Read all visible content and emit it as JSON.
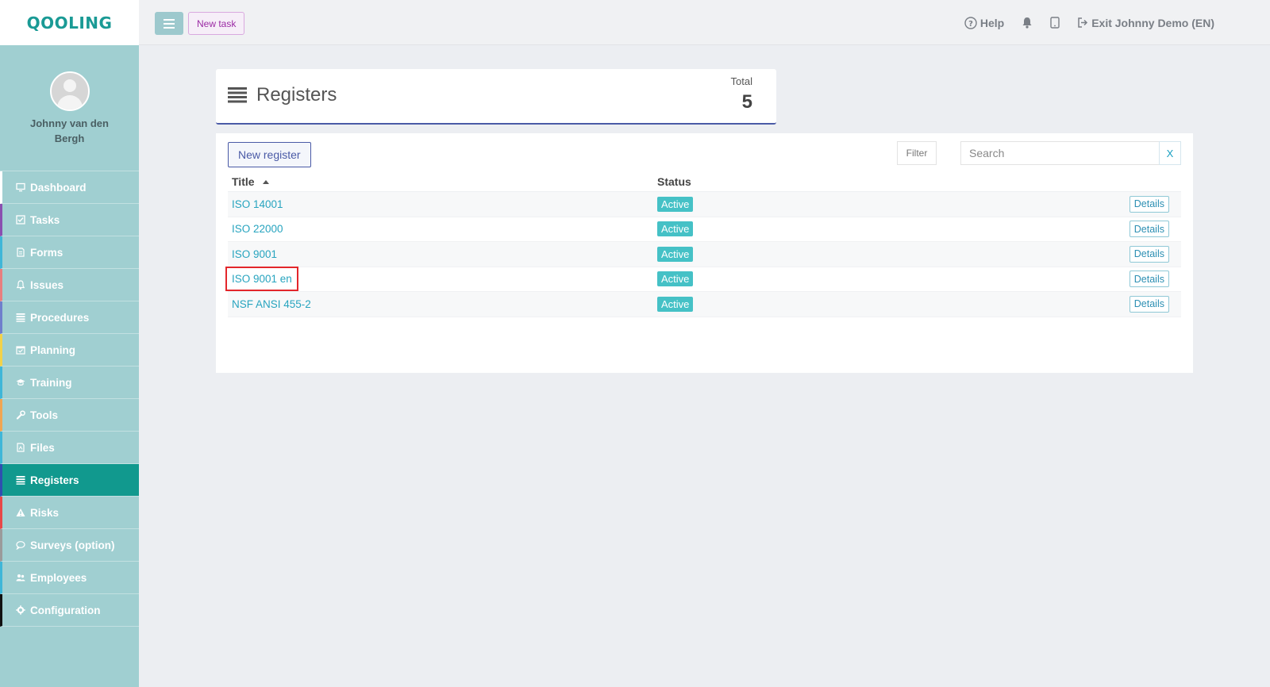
{
  "brand": {
    "logo_text": "QOOLING"
  },
  "user": {
    "name": "Johnny van den Bergh"
  },
  "sidebar": {
    "items": [
      {
        "label": "Dashboard",
        "icon": "monitor-icon",
        "color": "#ffffff"
      },
      {
        "label": "Tasks",
        "icon": "checkbox-icon",
        "color": "#8a4fb0"
      },
      {
        "label": "Forms",
        "icon": "document-icon",
        "color": "#3fb6d8"
      },
      {
        "label": "Issues",
        "icon": "bell-icon",
        "color": "#e87f7f"
      },
      {
        "label": "Procedures",
        "icon": "list-icon",
        "color": "#6f7fcc"
      },
      {
        "label": "Planning",
        "icon": "calendar-icon",
        "color": "#f2d24a"
      },
      {
        "label": "Training",
        "icon": "graduation-cap-icon",
        "color": "#3fb6d8"
      },
      {
        "label": "Tools",
        "icon": "wrench-icon",
        "color": "#f0a552"
      },
      {
        "label": "Files",
        "icon": "file-icon",
        "color": "#3fb6d8"
      },
      {
        "label": "Registers",
        "icon": "list-icon",
        "color": "#2f4fb0",
        "active": true
      },
      {
        "label": "Risks",
        "icon": "warning-icon",
        "color": "#e84848"
      },
      {
        "label": "Surveys (option)",
        "icon": "comment-icon",
        "color": "#9a9a9a"
      },
      {
        "label": "Employees",
        "icon": "users-icon",
        "color": "#3fb6d8"
      },
      {
        "label": "Configuration",
        "icon": "gear-icon",
        "color": "#111111"
      }
    ]
  },
  "topbar": {
    "new_task_label": "New task",
    "help_label": "Help",
    "exit_label": "Exit Johnny Demo (EN)"
  },
  "header": {
    "title": "Registers",
    "total_label": "Total",
    "total_value": "5"
  },
  "toolbar": {
    "new_register_label": "New register",
    "filter_label": "Filter",
    "search_placeholder": "Search",
    "clear_label": "X"
  },
  "table": {
    "columns": {
      "title": "Title",
      "status": "Status"
    },
    "rows": [
      {
        "title": "ISO 14001",
        "status": "Active",
        "action": "Details"
      },
      {
        "title": "ISO 22000",
        "status": "Active",
        "action": "Details"
      },
      {
        "title": "ISO 9001",
        "status": "Active",
        "action": "Details"
      },
      {
        "title": "ISO 9001 en",
        "status": "Active",
        "action": "Details",
        "highlighted": true
      },
      {
        "title": "NSF ANSI 455-2",
        "status": "Active",
        "action": "Details"
      }
    ]
  },
  "colors": {
    "accent": "#11998e",
    "link": "#27a4bf",
    "badge": "#45c1c6",
    "highlight_box": "#e3262b"
  }
}
